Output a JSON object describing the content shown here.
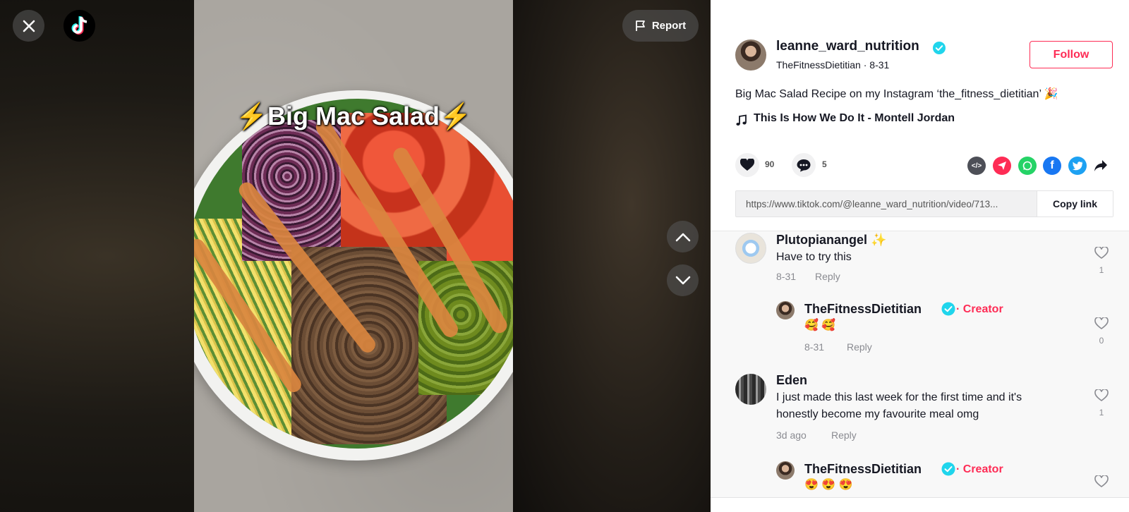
{
  "video": {
    "title_bolt_left": "⚡",
    "title_text": "Big Mac Salad",
    "title_bolt_right": "⚡",
    "report_label": "Report"
  },
  "post": {
    "author_name": "leanne_ward_nutrition",
    "author_nickname": "TheFitnessDietitian",
    "separator": "·",
    "date": "8-31",
    "follow_label": "Follow",
    "description": "Big Mac Salad Recipe on my Instagram ‘the_fitness_dietitian’ 🎉",
    "music": "This Is How We Do It - Montell Jordan",
    "like_count": "90",
    "comment_count": "5",
    "link_url": "https://www.tiktok.com/@leanne_ward_nutrition/video/713...",
    "copy_link_label": "Copy link"
  },
  "comments": [
    {
      "user": "Plutopianangel ✨",
      "text": "Have to try this",
      "date": "8-31",
      "reply_label": "Reply",
      "likes": "1",
      "replies": [
        {
          "user": "TheFitnessDietitian",
          "badge": "· Creator",
          "text": "🥰 🥰",
          "date": "8-31",
          "reply_label": "Reply",
          "likes": "0"
        }
      ]
    },
    {
      "user": "Eden",
      "text_line1": "I just made this last week for the first time and it's",
      "text_line2": "honestly become my favourite meal omg",
      "date": "3d ago",
      "reply_label": "Reply",
      "likes": "1",
      "replies": [
        {
          "user": "TheFitnessDietitian",
          "badge": "· Creator",
          "text": "😍 😍 😍"
        }
      ]
    }
  ],
  "colors": {
    "brand_red": "#fe2c55",
    "verified_blue": "#20d5ec",
    "text_primary": "#161823",
    "text_secondary": "#8a8b91"
  },
  "icons": [
    "close-icon",
    "tiktok-logo-icon",
    "flag-icon",
    "chevron-up-icon",
    "chevron-down-icon",
    "verified-icon",
    "music-note-icon",
    "heart-icon",
    "comment-icon",
    "embed-icon",
    "send-icon",
    "whatsapp-icon",
    "facebook-icon",
    "twitter-icon",
    "share-forward-icon"
  ]
}
